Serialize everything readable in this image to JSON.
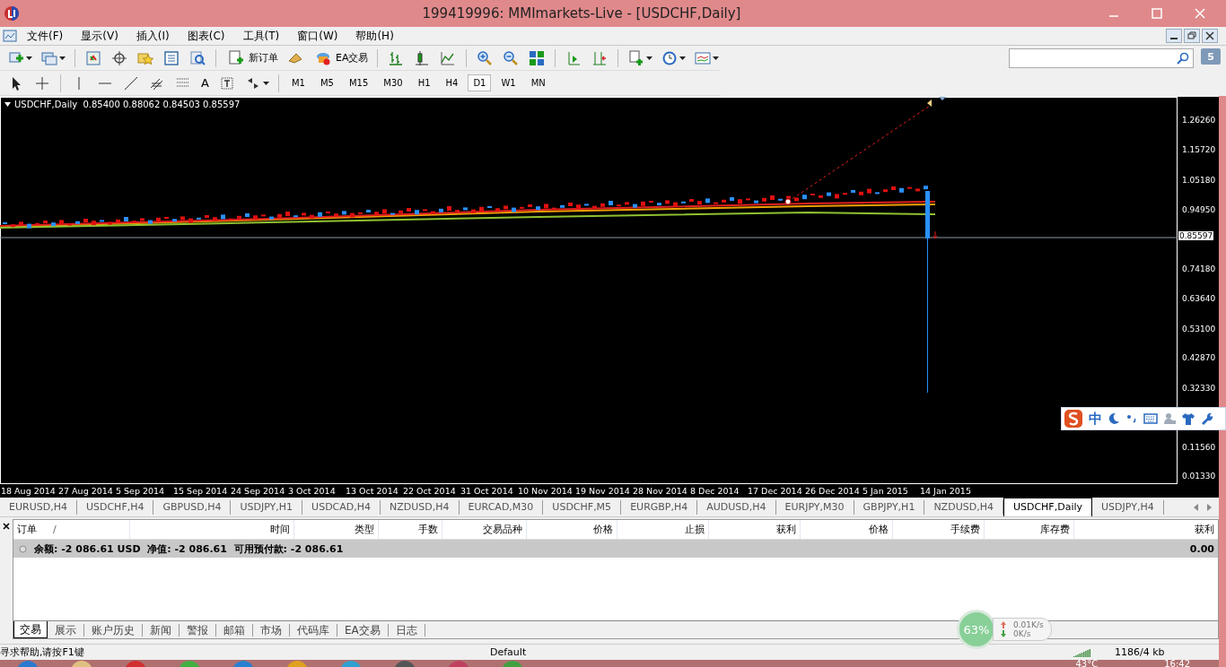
{
  "window": {
    "title": "199419996: MMImarkets-Live - [USDCHF,Daily]"
  },
  "menu": [
    "文件(F)",
    "显示(V)",
    "插入(I)",
    "图表(C)",
    "工具(T)",
    "窗口(W)",
    "帮助(H)"
  ],
  "toolbar": {
    "labeled_buttons": [
      "新订单",
      "EA交易"
    ]
  },
  "drawing_toolbar": {
    "text_tool": "A",
    "timeframes": [
      {
        "label": "M1",
        "selected": false
      },
      {
        "label": "M5",
        "selected": false
      },
      {
        "label": "M15",
        "selected": false
      },
      {
        "label": "M30",
        "selected": false
      },
      {
        "label": "H1",
        "selected": false
      },
      {
        "label": "H4",
        "selected": false
      },
      {
        "label": "D1",
        "selected": true
      },
      {
        "label": "W1",
        "selected": false
      },
      {
        "label": "MN",
        "selected": false
      }
    ]
  },
  "search": {
    "badge": "5"
  },
  "chart": {
    "header": "USDCHF,Daily  0.85400 0.88062 0.84503 0.85597",
    "price_labels": [
      "1.26260",
      "1.15720",
      "1.05180",
      "0.94950",
      "0.74180",
      "0.63640",
      "0.53100",
      "0.42870",
      "0.32330",
      "0.11560",
      "0.01330"
    ],
    "current_price": "0.85597",
    "date_labels": [
      "18 Aug 2014",
      "27 Aug 2014",
      "5 Sep 2014",
      "15 Sep 2014",
      "24 Sep 2014",
      "3 Oct 2014",
      "13 Oct 2014",
      "22 Oct 2014",
      "31 Oct 2014",
      "10 Nov 2014",
      "19 Nov 2014",
      "28 Nov 2014",
      "8 Dec 2014",
      "17 Dec 2014",
      "26 Dec 2014",
      "5 Jan 2015",
      "14 Jan 2015"
    ]
  },
  "chart_tabs": [
    {
      "label": "EURUSD,H4",
      "selected": false
    },
    {
      "label": "USDCHF,H4",
      "selected": false
    },
    {
      "label": "GBPUSD,H4",
      "selected": false
    },
    {
      "label": "USDJPY,H1",
      "selected": false
    },
    {
      "label": "USDCAD,H4",
      "selected": false
    },
    {
      "label": "NZDUSD,H4",
      "selected": false
    },
    {
      "label": "EURCAD,M30",
      "selected": false
    },
    {
      "label": "USDCHF,M5",
      "selected": false
    },
    {
      "label": "EURGBP,H4",
      "selected": false
    },
    {
      "label": "AUDUSD,H4",
      "selected": false
    },
    {
      "label": "EURJPY,M30",
      "selected": false
    },
    {
      "label": "GBPJPY,H1",
      "selected": false
    },
    {
      "label": "NZDUSD,H4",
      "selected": false
    },
    {
      "label": "USDCHF,Daily",
      "selected": true
    },
    {
      "label": "USDJPY,H4",
      "selected": false
    }
  ],
  "terminal": {
    "columns": [
      "订单",
      "时间",
      "类型",
      "手数",
      "交易品种",
      "价格",
      "止损",
      "获利",
      "价格",
      "手续费",
      "库存费",
      "获利"
    ],
    "sort_mark": "/",
    "balance_row": {
      "text": "余额: -2 086.61 USD  净值: -2 086.61  可用预付款: -2 086.61",
      "profit": "0.00"
    },
    "tabs": [
      {
        "label": "交易",
        "selected": true
      },
      {
        "label": "展示",
        "selected": false
      },
      {
        "label": "账户历史",
        "selected": false
      },
      {
        "label": "新闻",
        "selected": false
      },
      {
        "label": "警报",
        "selected": false
      },
      {
        "label": "邮箱",
        "selected": false
      },
      {
        "label": "市场",
        "selected": false
      },
      {
        "label": "代码库",
        "selected": false
      },
      {
        "label": "EA交易",
        "selected": false
      },
      {
        "label": "日志",
        "selected": false
      }
    ]
  },
  "status_bar": {
    "help": "寻求帮助,请按F1键",
    "profile": "Default",
    "traffic": "1186/4 kb"
  },
  "network_widget": {
    "percent": "63%",
    "upload": "0.01K/s",
    "download": "0K/s"
  },
  "ime_bar": {
    "mode": "中"
  },
  "taskbar": {
    "temperature": "43°C",
    "time": "16:42"
  }
}
